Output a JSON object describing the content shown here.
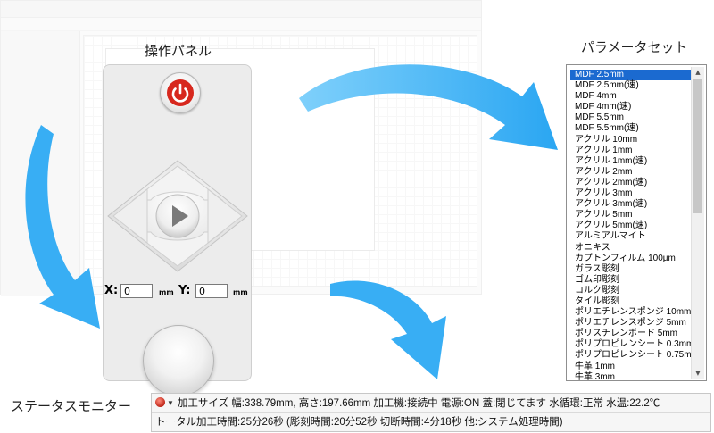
{
  "labels": {
    "control_panel": "操作パネル",
    "parameter_set": "パラメータセット",
    "status_monitor": "ステータスモニター"
  },
  "coords": {
    "x_label": "X:",
    "x_value": "0",
    "y_label": "Y:",
    "y_value": "0",
    "unit": "mm"
  },
  "icons": {
    "power": "power-icon",
    "play": "play-icon",
    "knob": "knob-icon",
    "led": "status-led-icon",
    "dropdown": "chevron-down-icon"
  },
  "colors": {
    "accent_arrow": "#3fb2f5",
    "power_red": "#d7281e",
    "selection": "#1b6ad0"
  },
  "parameters": [
    "MDF 2.5mm",
    "MDF 2.5mm(速)",
    "MDF 4mm",
    "MDF 4mm(速)",
    "MDF 5.5mm",
    "MDF 5.5mm(速)",
    "アクリル 10mm",
    "アクリル 1mm",
    "アクリル 1mm(速)",
    "アクリル 2mm",
    "アクリル 2mm(速)",
    "アクリル 3mm",
    "アクリル 3mm(速)",
    "アクリル 5mm",
    "アクリル 5mm(速)",
    "アルミアルマイト",
    "オニキス",
    "カプトンフィルム 100μm",
    "ガラス彫刻",
    "ゴム印彫刻",
    "コルク彫刻",
    "タイル彫刻",
    "ポリエチレンスポンジ 10mm",
    "ポリエチレンスポンジ 5mm",
    "ポリスチレンボード 5mm",
    "ポリプロピレンシート 0.3mm",
    "ポリプロピレンシート 0.75mm",
    "牛革 1mm",
    "牛革 3mm"
  ],
  "selected_parameter": "MDF 2.5mm",
  "status": {
    "line1": "加工サイズ 幅:338.79mm, 高さ:197.66mm  加工機:接続中  電源:ON  蓋:閉じてます  水循環:正常  水温:22.2℃",
    "line2": "トータル加工時間:25分26秒 (彫刻時間:20分52秒 切断時間:4分18秒 他:システム処理時間)"
  },
  "scrollbar": {
    "up": "▲",
    "down": "▼"
  }
}
